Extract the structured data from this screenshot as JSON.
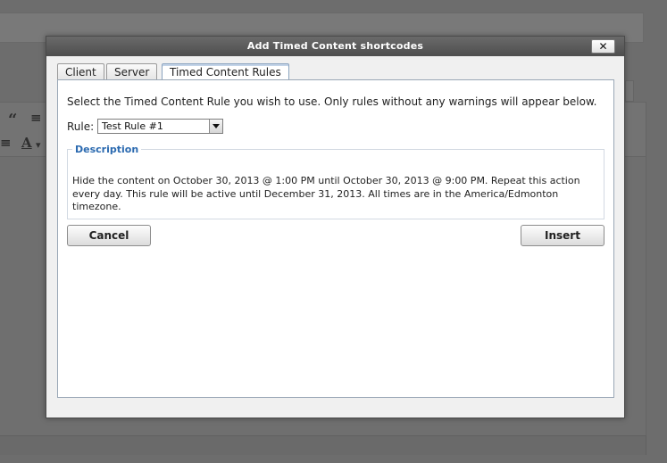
{
  "background": {
    "toolbar_icons": {
      "quote": "“",
      "align": "≡",
      "align2": "≡",
      "font_color": "A",
      "dropdown": "▾"
    }
  },
  "dialog": {
    "title": "Add Timed Content shortcodes",
    "close_label": "✕",
    "tabs": [
      {
        "label": "Client",
        "active": false
      },
      {
        "label": "Server",
        "active": false
      },
      {
        "label": "Timed Content Rules",
        "active": true
      }
    ],
    "intro": "Select the Timed Content Rule you wish to use. Only rules without any warnings will appear below.",
    "rule": {
      "label": "Rule:",
      "selected": "Test Rule #1"
    },
    "description": {
      "legend": "Description",
      "text": "Hide the content on October 30, 2013 @ 1:00 PM until October 30, 2013 @ 9:00 PM. Repeat this action every day. This rule will be active until December 31, 2013. All times are in the America/Edmonton timezone."
    },
    "buttons": {
      "cancel": "Cancel",
      "insert": "Insert"
    }
  },
  "colors": {
    "overlay": "#6d6d6d",
    "title_bar": "#555555",
    "legend": "#2b6ab0"
  }
}
